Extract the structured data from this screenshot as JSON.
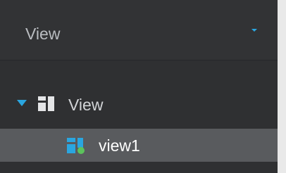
{
  "header": {
    "title": "View"
  },
  "tree": {
    "root": {
      "label": "View",
      "expanded": true,
      "icon": "view-group-icon"
    },
    "children": [
      {
        "label": "view1",
        "icon": "view-layout-online-icon",
        "selected": true
      }
    ]
  },
  "colors": {
    "accent": "#2aa6e0",
    "online": "#5cc35c",
    "panel_background": "#2f3032",
    "selected_row": "#595b5e"
  }
}
